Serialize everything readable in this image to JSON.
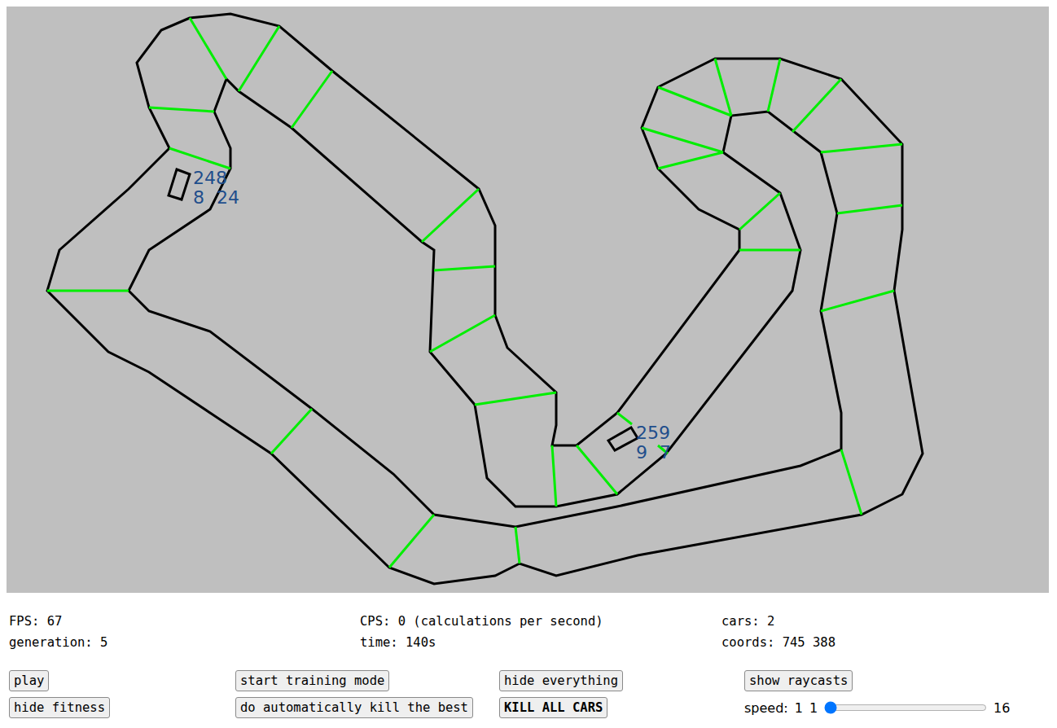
{
  "canvas": {
    "cars": [
      {
        "fitness": "248",
        "left": "8",
        "right": "24"
      },
      {
        "fitness": "259",
        "left": "9",
        "right": "7"
      }
    ]
  },
  "stats": [
    "FPS: 67",
    "CPS: 0 (calculations per second)",
    "cars: 2",
    "generation: 5",
    "time: 140s",
    "coords: 745 388"
  ],
  "buttons": [
    {
      "label": "play",
      "bold": false
    },
    {
      "label": "start training mode",
      "bold": false
    },
    {
      "label": "hide everything",
      "bold": false
    },
    {
      "label": "show raycasts",
      "bold": false
    },
    {
      "label": "hide fitness",
      "bold": false
    },
    {
      "label": "do automatically kill the best",
      "bold": false
    },
    {
      "label": "KILL ALL CARS",
      "bold": true
    }
  ],
  "speed": {
    "label": "speed:",
    "value": "1",
    "min": "1",
    "max": "16",
    "level": 0
  }
}
